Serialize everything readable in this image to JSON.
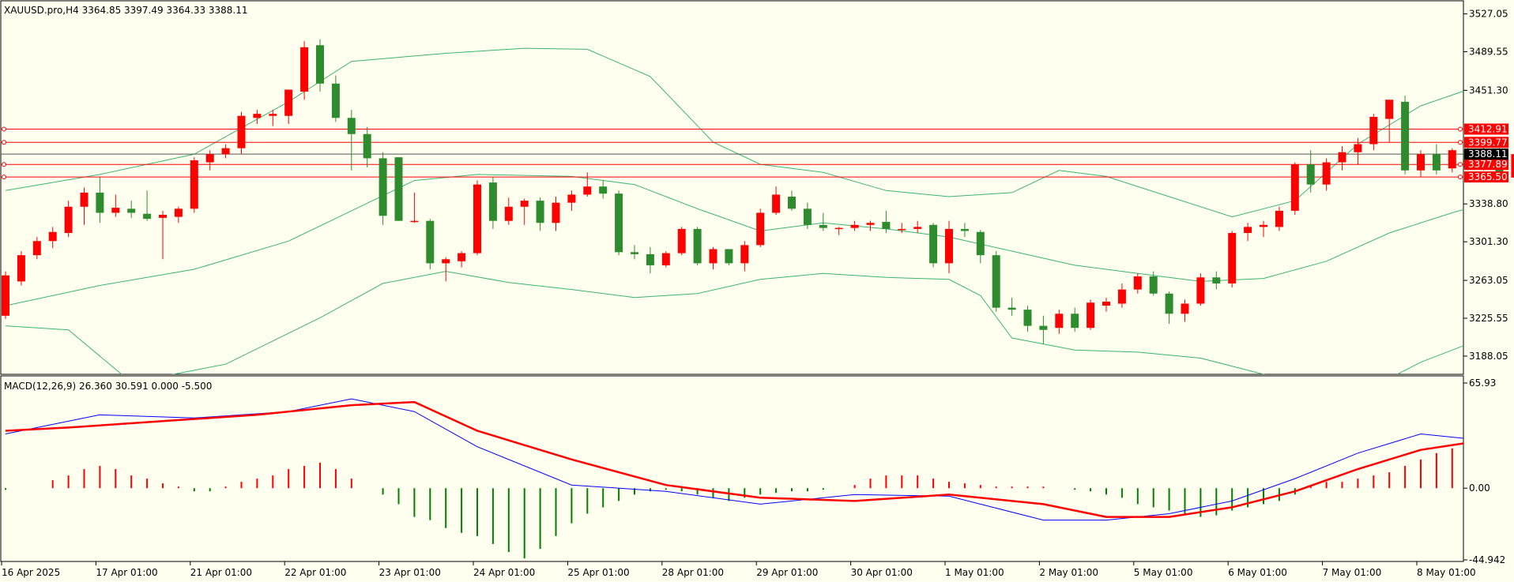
{
  "chart_title": "XAUUSD.pro,H4  3364.85 3397.49 3364.33 3388.11",
  "colors": {
    "background": "#fffff0",
    "bull": "#ff0000",
    "bear": "#2e8b2e",
    "bands": "#3cb371",
    "hline": "#ff0000",
    "current_line": "#000000",
    "macd_line": "#0000ff",
    "signal_line": "#ff0000",
    "hist_pos": "#ff0000",
    "hist_neg": "#008000"
  },
  "chart_data": [
    {
      "type": "candlestick",
      "symbol": "XAUUSD.pro",
      "timeframe": "H4",
      "ohlc_header": [
        "3364.85",
        "3397.49",
        "3364.33",
        "3388.11"
      ],
      "ylim": [
        3170,
        3540
      ],
      "y_ticks": [
        "3527.05",
        "3489.55",
        "3451.30",
        "3338.80",
        "3301.30",
        "3263.05",
        "3225.55",
        "3188.05"
      ],
      "x_ticks": [
        "16 Apr 2025",
        "17 Apr 01:00",
        "21 Apr 01:00",
        "22 Apr 01:00",
        "23 Apr 01:00",
        "24 Apr 01:00",
        "25 Apr 01:00",
        "28 Apr 01:00",
        "29 Apr 01:00",
        "30 Apr 01:00",
        "1 May 01:00",
        "2 May 01:00",
        "5 May 01:00",
        "6 May 01:00",
        "7 May 01:00",
        "8 May 01:00"
      ],
      "horizontal_levels": [
        "3412.91",
        "3399.77",
        "3377.89",
        "3365.50"
      ],
      "current_price": "3388.11",
      "candles": [
        [
          3228,
          3272,
          3225,
          3268
        ],
        [
          3262,
          3292,
          3258,
          3288
        ],
        [
          3288,
          3306,
          3284,
          3302
        ],
        [
          3302,
          3316,
          3295,
          3311
        ],
        [
          3310,
          3342,
          3306,
          3336
        ],
        [
          3336,
          3355,
          3318,
          3350
        ],
        [
          3350,
          3366,
          3320,
          3330
        ],
        [
          3330,
          3348,
          3326,
          3335
        ],
        [
          3334,
          3342,
          3325,
          3330
        ],
        [
          3329,
          3352,
          3322,
          3324
        ],
        [
          3325,
          3332,
          3284,
          3328
        ],
        [
          3326,
          3336,
          3320,
          3334
        ],
        [
          3334,
          3385,
          3330,
          3382
        ],
        [
          3380,
          3392,
          3372,
          3388
        ],
        [
          3388,
          3398,
          3384,
          3394
        ],
        [
          3394,
          3430,
          3388,
          3426
        ],
        [
          3424,
          3432,
          3418,
          3428
        ],
        [
          3426,
          3432,
          3416,
          3428
        ],
        [
          3426,
          3450,
          3418,
          3452
        ],
        [
          3450,
          3500,
          3442,
          3494
        ],
        [
          3496,
          3502,
          3450,
          3458
        ],
        [
          3458,
          3466,
          3420,
          3424
        ],
        [
          3424,
          3432,
          3372,
          3408
        ],
        [
          3408,
          3415,
          3375,
          3384
        ],
        [
          3384,
          3390,
          3318,
          3327
        ],
        [
          3385,
          3385,
          3322,
          3322
        ],
        [
          3322,
          3350,
          3320,
          3322
        ],
        [
          3322,
          3324,
          3274,
          3280
        ],
        [
          3280,
          3286,
          3262,
          3284
        ],
        [
          3282,
          3292,
          3276,
          3290
        ],
        [
          3290,
          3362,
          3288,
          3358
        ],
        [
          3360,
          3366,
          3314,
          3322
        ],
        [
          3322,
          3345,
          3318,
          3336
        ],
        [
          3336,
          3344,
          3318,
          3342
        ],
        [
          3342,
          3345,
          3312,
          3320
        ],
        [
          3320,
          3346,
          3312,
          3340
        ],
        [
          3340,
          3352,
          3332,
          3348
        ],
        [
          3348,
          3370,
          3346,
          3356
        ],
        [
          3356,
          3362,
          3344,
          3349
        ],
        [
          3349,
          3352,
          3288,
          3291
        ],
        [
          3291,
          3298,
          3284,
          3289
        ],
        [
          3289,
          3296,
          3270,
          3278
        ],
        [
          3278,
          3292,
          3276,
          3290
        ],
        [
          3290,
          3316,
          3288,
          3314
        ],
        [
          3314,
          3316,
          3278,
          3280
        ],
        [
          3280,
          3296,
          3274,
          3294
        ],
        [
          3294,
          3294,
          3278,
          3280
        ],
        [
          3280,
          3302,
          3272,
          3298
        ],
        [
          3298,
          3334,
          3296,
          3330
        ],
        [
          3330,
          3356,
          3328,
          3348
        ],
        [
          3346,
          3352,
          3332,
          3334
        ],
        [
          3334,
          3340,
          3314,
          3318
        ],
        [
          3318,
          3330,
          3312,
          3315
        ],
        [
          3314,
          3316,
          3308,
          3315
        ],
        [
          3315,
          3322,
          3312,
          3318
        ],
        [
          3318,
          3322,
          3312,
          3320
        ],
        [
          3321,
          3332,
          3310,
          3314
        ],
        [
          3314,
          3320,
          3310,
          3314
        ],
        [
          3314,
          3322,
          3310,
          3316
        ],
        [
          3318,
          3320,
          3276,
          3280
        ],
        [
          3280,
          3322,
          3270,
          3314
        ],
        [
          3314,
          3320,
          3306,
          3312
        ],
        [
          3311,
          3313,
          3280,
          3288
        ],
        [
          3288,
          3292,
          3232,
          3236
        ],
        [
          3236,
          3246,
          3228,
          3234
        ],
        [
          3234,
          3238,
          3212,
          3218
        ],
        [
          3218,
          3228,
          3200,
          3214
        ],
        [
          3216,
          3234,
          3210,
          3230
        ],
        [
          3230,
          3236,
          3212,
          3216
        ],
        [
          3216,
          3244,
          3214,
          3241
        ],
        [
          3238,
          3246,
          3232,
          3242
        ],
        [
          3240,
          3260,
          3236,
          3254
        ],
        [
          3254,
          3270,
          3250,
          3267
        ],
        [
          3267,
          3272,
          3248,
          3250
        ],
        [
          3250,
          3252,
          3220,
          3230
        ],
        [
          3230,
          3244,
          3222,
          3240
        ],
        [
          3240,
          3270,
          3238,
          3266
        ],
        [
          3266,
          3272,
          3254,
          3260
        ],
        [
          3260,
          3312,
          3256,
          3310
        ],
        [
          3310,
          3320,
          3302,
          3316
        ],
        [
          3316,
          3322,
          3306,
          3318
        ],
        [
          3316,
          3336,
          3312,
          3332
        ],
        [
          3332,
          3380,
          3328,
          3378
        ],
        [
          3378,
          3392,
          3350,
          3358
        ],
        [
          3358,
          3384,
          3352,
          3380
        ],
        [
          3380,
          3396,
          3372,
          3390
        ],
        [
          3390,
          3404,
          3378,
          3398
        ],
        [
          3398,
          3428,
          3392,
          3425
        ],
        [
          3423,
          3434,
          3400,
          3442
        ],
        [
          3440,
          3446,
          3368,
          3372
        ],
        [
          3372,
          3392,
          3366,
          3388
        ],
        [
          3388,
          3398,
          3368,
          3372
        ],
        [
          3374,
          3394,
          3370,
          3392
        ],
        [
          3392,
          3398,
          3372,
          3374
        ],
        [
          3374,
          3396,
          3372,
          3392
        ],
        [
          3390,
          3394,
          3364,
          3366
        ],
        [
          3364.85,
          3397.49,
          3364.33,
          3388.11
        ]
      ],
      "bollinger": {
        "upper": [
          [
            0,
            3352
          ],
          [
            6,
            3368
          ],
          [
            12,
            3388
          ],
          [
            18,
            3440
          ],
          [
            22,
            3480
          ],
          [
            28,
            3488
          ],
          [
            33,
            3493
          ],
          [
            37,
            3492
          ],
          [
            41,
            3465
          ],
          [
            45,
            3400
          ],
          [
            48,
            3378
          ],
          [
            52,
            3370
          ],
          [
            56,
            3352
          ],
          [
            60,
            3346
          ],
          [
            64,
            3350
          ],
          [
            67,
            3372
          ],
          [
            70,
            3366
          ],
          [
            74,
            3346
          ],
          [
            78,
            3326
          ],
          [
            82,
            3342
          ],
          [
            86,
            3398
          ],
          [
            90,
            3436
          ],
          [
            93,
            3452
          ],
          [
            96,
            3455
          ]
        ],
        "middle": [
          [
            0,
            3238
          ],
          [
            6,
            3258
          ],
          [
            12,
            3274
          ],
          [
            18,
            3302
          ],
          [
            22,
            3332
          ],
          [
            26,
            3362
          ],
          [
            30,
            3368
          ],
          [
            36,
            3366
          ],
          [
            40,
            3358
          ],
          [
            44,
            3334
          ],
          [
            48,
            3312
          ],
          [
            52,
            3320
          ],
          [
            56,
            3314
          ],
          [
            60,
            3306
          ],
          [
            64,
            3292
          ],
          [
            68,
            3278
          ],
          [
            72,
            3270
          ],
          [
            76,
            3262
          ],
          [
            80,
            3265
          ],
          [
            84,
            3282
          ],
          [
            88,
            3310
          ],
          [
            92,
            3330
          ],
          [
            96,
            3348
          ]
        ],
        "lower": [
          [
            0,
            3218
          ],
          [
            4,
            3214
          ],
          [
            8,
            3162
          ],
          [
            14,
            3180
          ],
          [
            20,
            3226
          ],
          [
            24,
            3260
          ],
          [
            28,
            3272
          ],
          [
            32,
            3261
          ],
          [
            36,
            3254
          ],
          [
            40,
            3246
          ],
          [
            44,
            3250
          ],
          [
            48,
            3264
          ],
          [
            52,
            3270
          ],
          [
            56,
            3266
          ],
          [
            60,
            3264
          ],
          [
            62,
            3248
          ],
          [
            64,
            3206
          ],
          [
            68,
            3194
          ],
          [
            72,
            3192
          ],
          [
            76,
            3186
          ],
          [
            80,
            3170
          ],
          [
            86,
            3150
          ],
          [
            90,
            3182
          ],
          [
            94,
            3206
          ],
          [
            96,
            3226
          ]
        ]
      }
    },
    {
      "type": "line",
      "indicator": "MACD(12,26,9)",
      "header_values": [
        "26.360",
        "30.591",
        "0.000",
        "-5.500"
      ],
      "ylim": [
        -44.942,
        65.93
      ],
      "y_ticks": [
        "65.93",
        "0.00",
        "-44.942"
      ],
      "macd": [
        [
          0,
          34
        ],
        [
          6,
          46
        ],
        [
          12,
          44
        ],
        [
          18,
          48
        ],
        [
          22,
          56
        ],
        [
          26,
          48
        ],
        [
          30,
          26
        ],
        [
          36,
          2
        ],
        [
          42,
          -2
        ],
        [
          48,
          -10
        ],
        [
          54,
          -4
        ],
        [
          60,
          -5
        ],
        [
          66,
          -20
        ],
        [
          70,
          -20
        ],
        [
          74,
          -16
        ],
        [
          78,
          -8
        ],
        [
          82,
          6
        ],
        [
          86,
          22
        ],
        [
          90,
          34
        ],
        [
          94,
          30
        ],
        [
          96,
          28
        ]
      ],
      "signal": [
        [
          0,
          36
        ],
        [
          4,
          38
        ],
        [
          10,
          42
        ],
        [
          16,
          46
        ],
        [
          22,
          52
        ],
        [
          26,
          54
        ],
        [
          30,
          36
        ],
        [
          36,
          18
        ],
        [
          42,
          2
        ],
        [
          48,
          -6
        ],
        [
          54,
          -8
        ],
        [
          60,
          -4
        ],
        [
          66,
          -10
        ],
        [
          70,
          -18
        ],
        [
          74,
          -18
        ],
        [
          78,
          -12
        ],
        [
          82,
          -2
        ],
        [
          86,
          12
        ],
        [
          90,
          24
        ],
        [
          94,
          30
        ],
        [
          96,
          31
        ]
      ],
      "histogram": [
        -1,
        0,
        0,
        5,
        8,
        12,
        14,
        12,
        8,
        6,
        3,
        1,
        -2,
        -2,
        1,
        4,
        6,
        8,
        12,
        14,
        16,
        12,
        6,
        0,
        -4,
        -10,
        -18,
        -20,
        -25,
        -28,
        -30,
        -35,
        -40,
        -44,
        -38,
        -30,
        -22,
        -16,
        -12,
        -8,
        -4,
        -2,
        -1,
        -2,
        -4,
        -6,
        -8,
        -6,
        -4,
        -3,
        -2,
        -2,
        -1,
        0,
        2,
        6,
        8,
        8,
        8,
        6,
        4,
        3,
        2,
        1,
        1,
        1,
        1,
        0,
        -1,
        -2,
        -4,
        -6,
        -10,
        -12,
        -14,
        -16,
        -18,
        -17,
        -14,
        -12,
        -10,
        -8,
        -4,
        2,
        4,
        4,
        6,
        8,
        10,
        14,
        18,
        22,
        25,
        26,
        26,
        24,
        22,
        14,
        10,
        6,
        2,
        -1,
        -4
      ]
    }
  ]
}
